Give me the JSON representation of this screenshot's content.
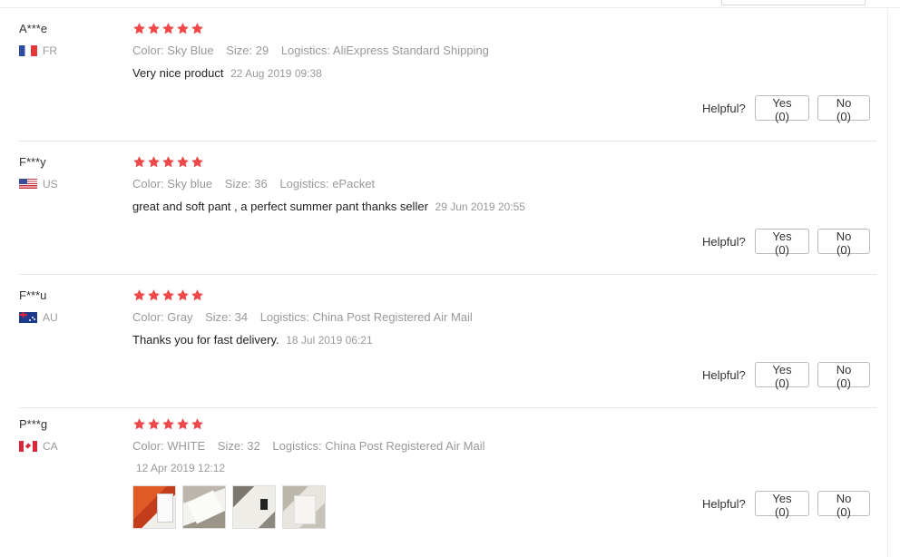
{
  "colors": {
    "star": "#f04848",
    "muted": "#999999",
    "text": "#333333",
    "divider": "#e6e6e6"
  },
  "helpful_label": "Helpful?",
  "reviews": [
    {
      "user": "A***e",
      "country": "FR",
      "flag_icon": "flag-fr-icon",
      "rating": 5,
      "color": "Color: Sky Blue",
      "size": "Size: 29",
      "logistics": "Logistics: AliExpress Standard Shipping",
      "comment": "Very nice product",
      "date": "22 Aug 2019 09:38",
      "yes": "Yes (0)",
      "no": "No (0)"
    },
    {
      "user": "F***y",
      "country": "US",
      "flag_icon": "flag-us-icon",
      "rating": 5,
      "color": "Color: Sky blue",
      "size": "Size: 36",
      "logistics": "Logistics: ePacket",
      "comment": "great and soft pant , a perfect summer pant thanks seller",
      "date": "29 Jun 2019 20:55",
      "yes": "Yes (0)",
      "no": "No (0)"
    },
    {
      "user": "F***u",
      "country": "AU",
      "flag_icon": "flag-au-icon",
      "rating": 5,
      "color": "Color: Gray",
      "size": "Size: 34",
      "logistics": "Logistics: China Post Registered Air Mail",
      "comment": "Thanks you for fast delivery.",
      "date": "18 Jul 2019 06:21",
      "yes": "Yes (0)",
      "no": "No (0)"
    },
    {
      "user": "P***g",
      "country": "CA",
      "flag_icon": "flag-ca-icon",
      "rating": 5,
      "color": "Color: WHITE",
      "size": "Size: 32",
      "logistics": "Logistics: China Post Registered Air Mail",
      "comment": "",
      "date": "12 Apr 2019 12:12",
      "photos": [
        "review-photo-1",
        "review-photo-2",
        "review-photo-3",
        "review-photo-4"
      ],
      "yes": "Yes (0)",
      "no": "No (0)"
    }
  ]
}
